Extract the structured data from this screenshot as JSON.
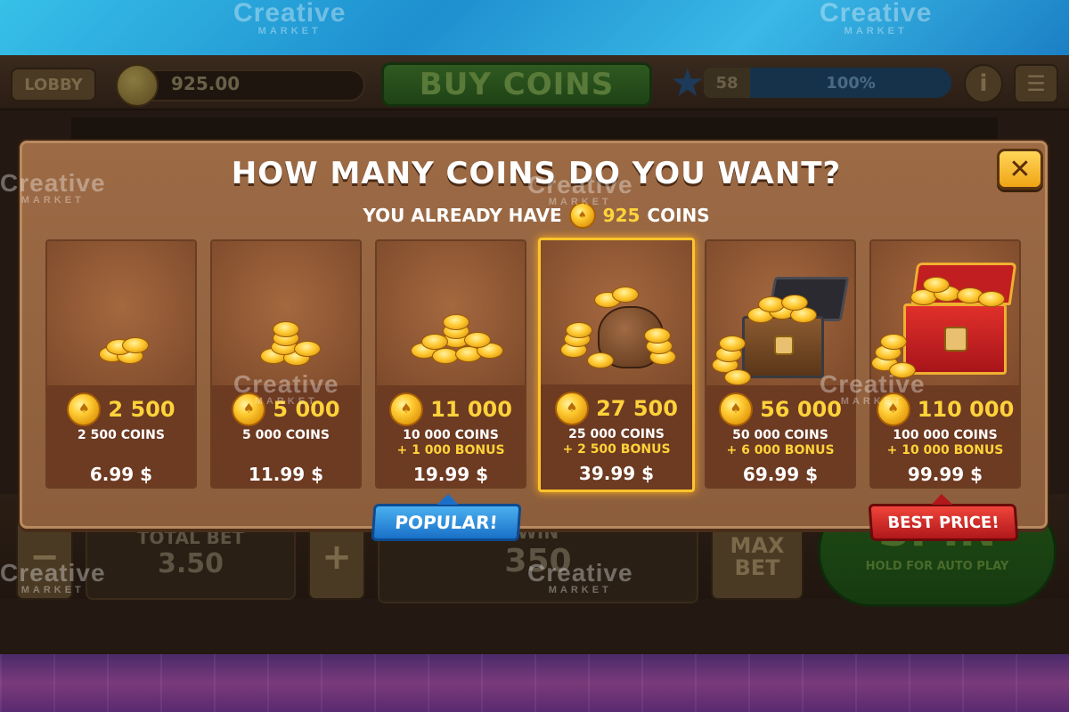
{
  "watermark": {
    "text": "Creative",
    "sub": "MARKET"
  },
  "game": {
    "lobby_label": "LOBBY",
    "balance": "925.00",
    "buy_coins_label": "BUY COINS",
    "level": "58",
    "level_progress": "100%",
    "level_fraction": 1.0,
    "info_label": "i",
    "menu_label": "☰",
    "minus_label": "−",
    "plus_label": "+",
    "total_bet_label": "TOTAL BET",
    "total_bet_value": "3.50",
    "win_label": "WIN",
    "win_value": "350",
    "max_bet_label": "MAX BET",
    "spin_label": "SPIN",
    "spin_sub": "HOLD FOR AUTO PLAY"
  },
  "modal": {
    "title": "HOW MANY COINS DO YOU WANT?",
    "close_label": "✕",
    "already_prefix": "YOU ALREADY HAVE",
    "already_amount": "925",
    "already_suffix": "COINS",
    "packages": [
      {
        "amount": "2 500",
        "coins": "2 500 COINS",
        "bonus": "",
        "price": "6.99 $"
      },
      {
        "amount": "5 000",
        "coins": "5 000 COINS",
        "bonus": "",
        "price": "11.99 $"
      },
      {
        "amount": "11 000",
        "coins": "10 000 COINS",
        "bonus": "+ 1 000 BONUS",
        "price": "19.99 $"
      },
      {
        "amount": "27 500",
        "coins": "25 000 COINS",
        "bonus": "+ 2 500 BONUS",
        "price": "39.99 $"
      },
      {
        "amount": "56 000",
        "coins": "50 000 COINS",
        "bonus": "+ 6 000 BONUS",
        "price": "69.99 $"
      },
      {
        "amount": "110 000",
        "coins": "100 000 COINS",
        "bonus": "+ 10 000 BONUS",
        "price": "99.99 $"
      }
    ],
    "popular_tag": "POPULAR!",
    "best_price_tag": "BEST PRICE!"
  },
  "colors": {
    "accent_gold": "#ffd23a",
    "panel_brown": "#9c6a45",
    "popular_blue": "#1a70c8",
    "best_red": "#b0181a",
    "selected_border": "#ffc42a"
  }
}
